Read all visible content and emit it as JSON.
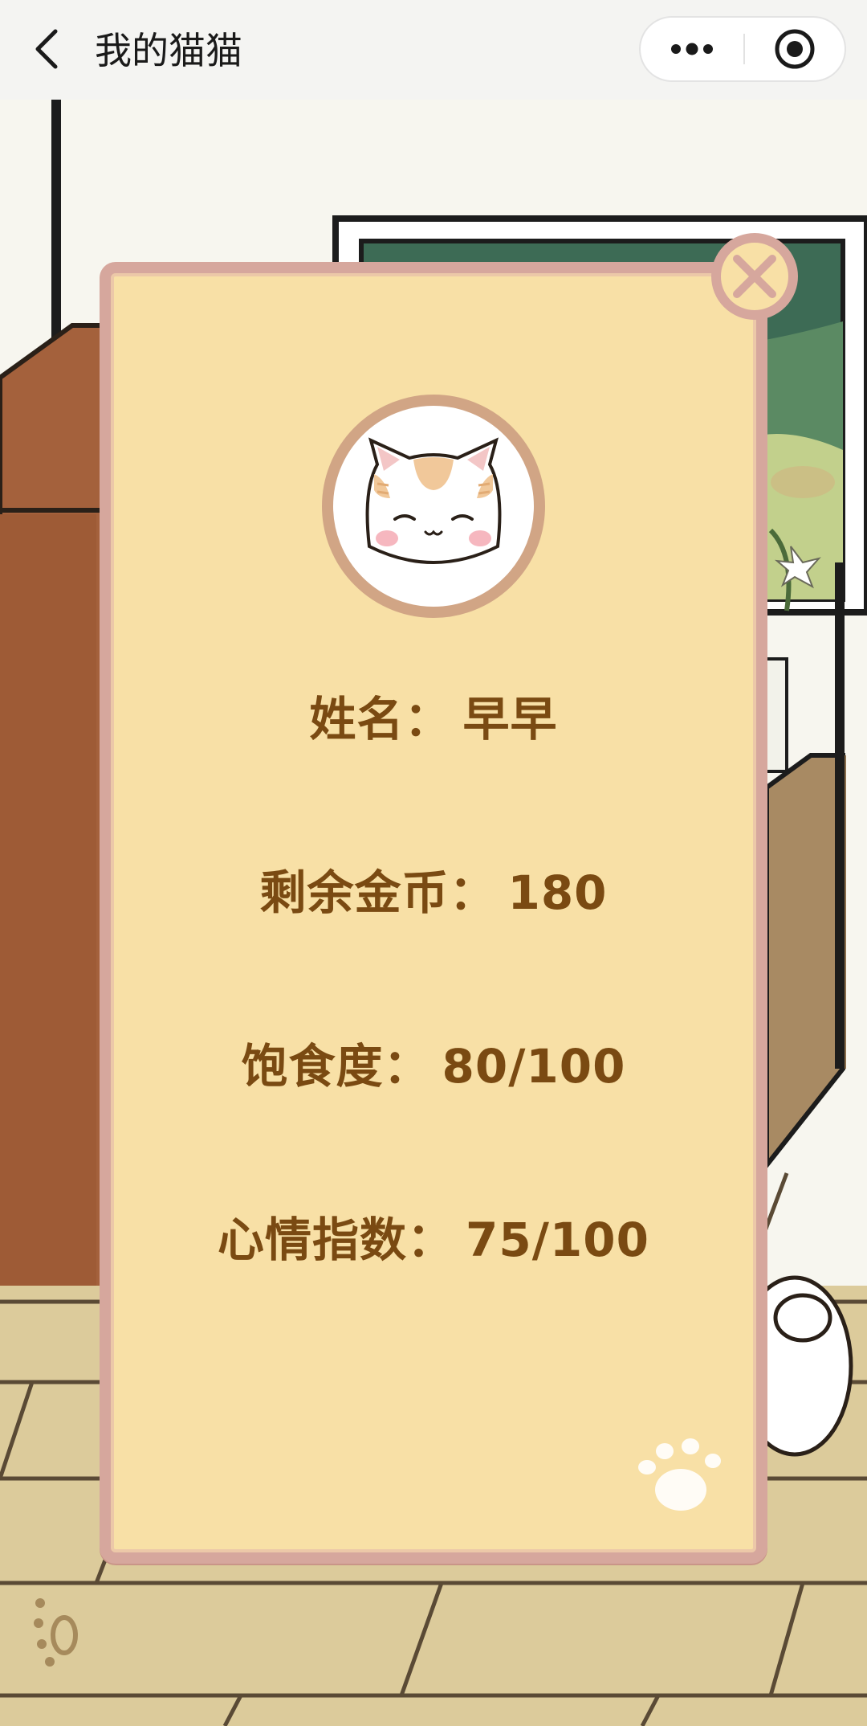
{
  "nav": {
    "title": "我的猫猫",
    "back_icon": "chevron-left-icon",
    "more_icon": "more-dots-icon",
    "close_icon": "target-circle-icon"
  },
  "card": {
    "close_icon": "close-x-icon",
    "avatar_icon": "cat-face-icon",
    "fields": [
      {
        "label": "姓名：",
        "value": "早早"
      },
      {
        "label": "剩余金币：",
        "value": "180"
      },
      {
        "label": "饱食度：",
        "value": "80/100"
      },
      {
        "label": "心情指数：",
        "value": "75/100"
      }
    ],
    "paw_icon": "paw-print-icon"
  },
  "colors": {
    "card_bg": "#f8e0a6",
    "card_border": "#d6a79d",
    "text_brown": "#7a4a12",
    "floor": "#dccb9b"
  }
}
